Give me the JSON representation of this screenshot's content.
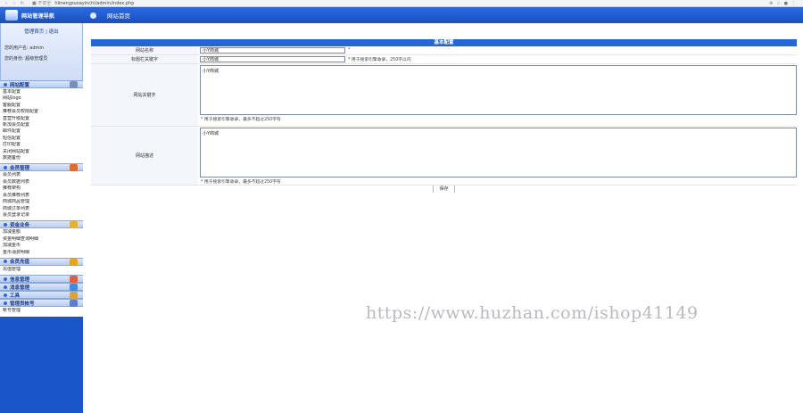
{
  "browser": {
    "back": "‹",
    "forward": "›",
    "reload": "↻",
    "secure": "■ 不安全",
    "url": "hlinengzuoayinchi/admin/index.php",
    "actions": [
      "⊕",
      "☆",
      "●",
      "⋮"
    ]
  },
  "sidebar": {
    "logo_text": "网站管理导航",
    "user_links": {
      "manage": "管理首页",
      "sep": "|",
      "logout": "退出"
    },
    "user_label": "您的用户名: admin",
    "role_label": "您的身份: 超级管理员",
    "sections": [
      {
        "title": "网站配置",
        "icon_color": "#7a8fb8",
        "items": [
          "基本配置",
          "网站logo",
          "客服配置",
          "推荐会员权限配置",
          "直营升级配置",
          "新加会员配置",
          "邮件配置",
          "短信配置",
          "打印配置",
          "关闭网站配置",
          "数据备份"
        ]
      },
      {
        "title": "会员管理",
        "icon_color": "#e06b2c",
        "items": [
          "会员列表",
          "会员数据列表",
          "推荐架构",
          "会员推荐列表",
          "商城商品管理",
          "商城订单列表",
          "会员登录记录"
        ]
      },
      {
        "title": "资金业务",
        "icon_color": "#e7b232",
        "items": [
          "加减金额",
          "资金明细查询明细",
          "加减金币",
          "金币消费明细"
        ]
      },
      {
        "title": "会员充值",
        "icon_color": "#e6a51f",
        "items": [
          "充值管理"
        ]
      },
      {
        "title": "信息管理",
        "icon_color": "#e05f3a",
        "items": []
      },
      {
        "title": "消息管理",
        "icon_color": "#3f8ae0",
        "items": []
      },
      {
        "title": "工具",
        "icon_color": "#d9a53a",
        "items": []
      },
      {
        "title": "管理员帐号",
        "icon_color": "#5b7fd0",
        "items": [
          "帐号管理"
        ]
      }
    ]
  },
  "header": {
    "title": "网站首页"
  },
  "form": {
    "section_title": "基本配置",
    "site_name": {
      "label": "网站名称",
      "value": "小Y商城",
      "suffix": "*"
    },
    "page_title": {
      "label": "标题栏关键字",
      "value": "小Y商城",
      "hint": "* 用于搜索引擎收录，250字以内"
    },
    "keywords": {
      "label": "网站关键字",
      "value": "小Y商城",
      "hint": "* 用于搜索引擎收录，最多不超过250字符"
    },
    "description": {
      "label": "网站描述",
      "value": "小Y商城",
      "hint": "* 用于搜索引擎收录，最多不超过250字符"
    },
    "save_label": "保存"
  },
  "watermark": "https://www.huzhan.com/ishop41149"
}
